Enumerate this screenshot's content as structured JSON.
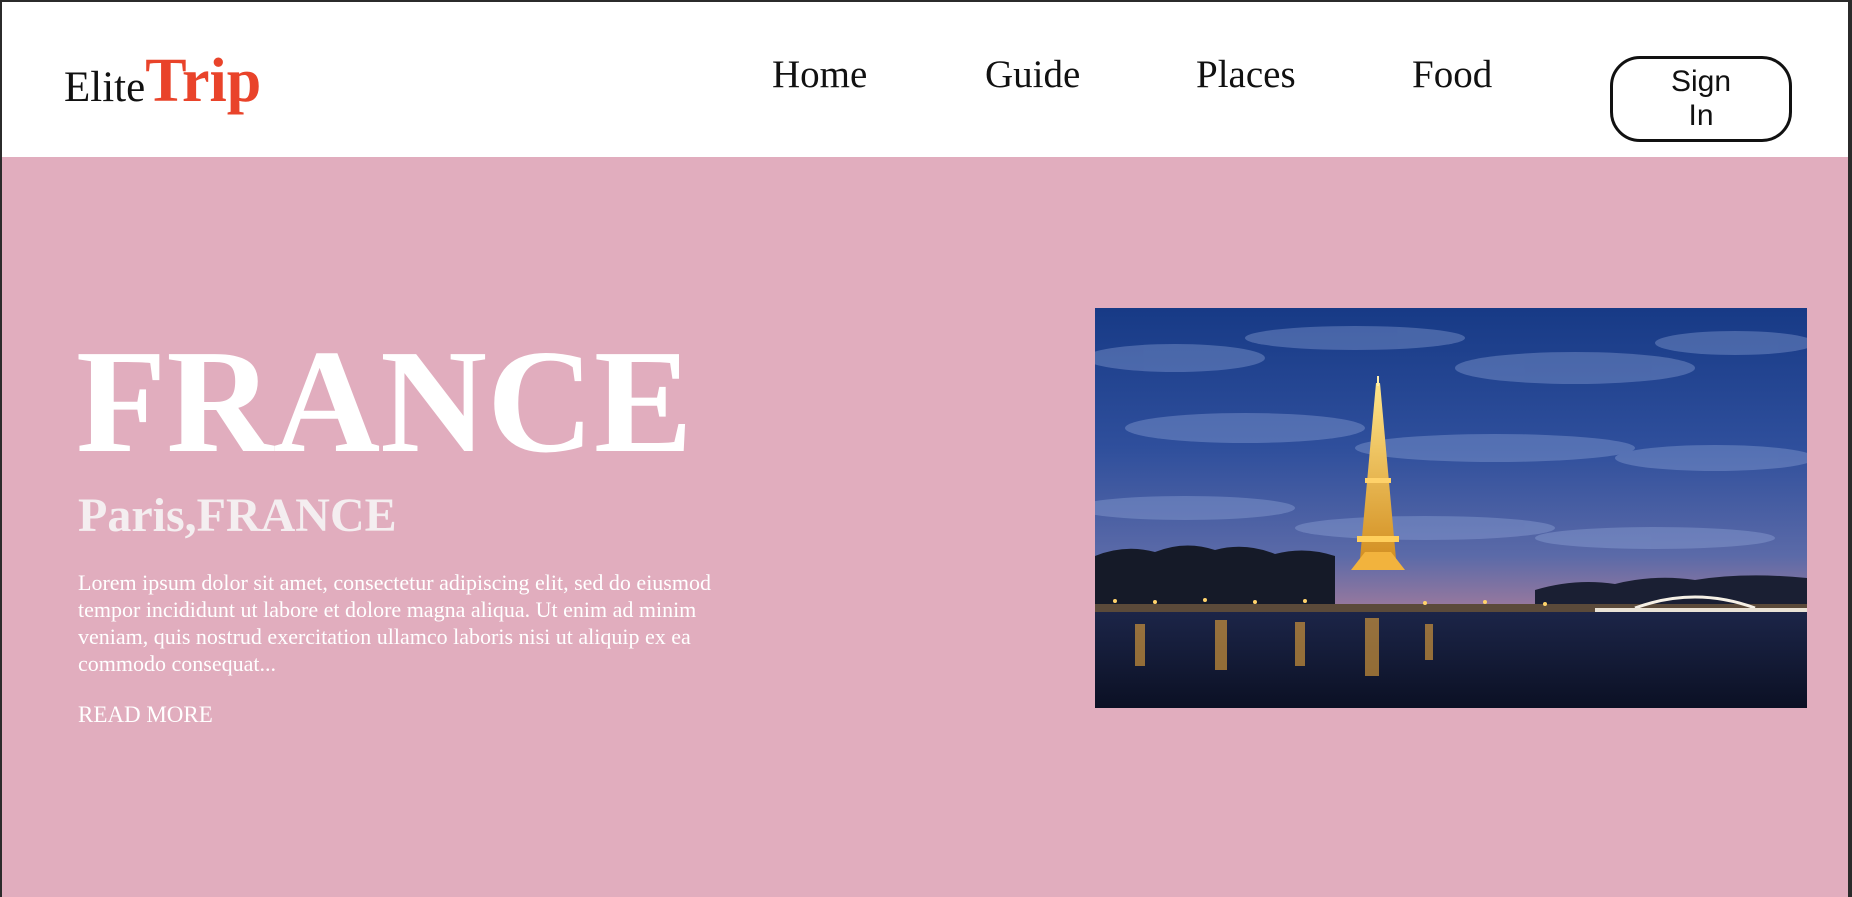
{
  "brand": {
    "part1": "Elite",
    "part2": "Trip",
    "accent_color": "#e9432a"
  },
  "nav": {
    "links": [
      "Home",
      "Guide",
      "Places",
      "Food"
    ],
    "signin_line1": "Sign",
    "signin_line2": "In"
  },
  "hero": {
    "background_color": "#e1adbe",
    "title": "FRANCE",
    "subtitle": "Paris,FRANCE",
    "description": "Lorem ipsum dolor sit amet, consectetur adipiscing elit, sed do eiusmod tempor incididunt ut labore et dolore magna aliqua. Ut enim ad minim veniam, quis nostrud exercitation ullamco laboris nisi ut aliquip ex ea commodo consequat...",
    "read_more": "READ MORE",
    "image_subject": "eiffel-tower-at-dusk-photo"
  }
}
